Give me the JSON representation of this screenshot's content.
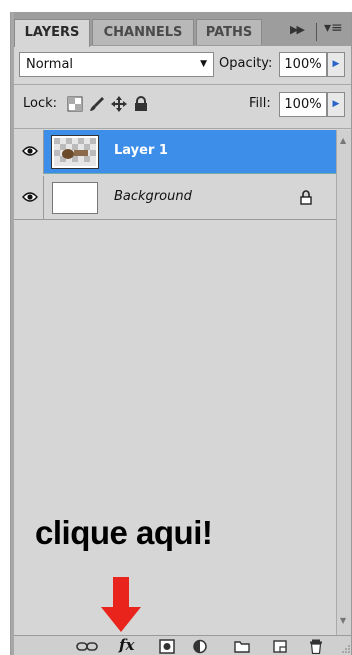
{
  "tabs": [
    {
      "label": "LAYERS",
      "active": true
    },
    {
      "label": "CHANNELS",
      "active": false
    },
    {
      "label": "PATHS",
      "active": false
    }
  ],
  "blend": {
    "mode": "Normal"
  },
  "opacity": {
    "label": "Opacity:",
    "value": "100%"
  },
  "lock": {
    "label": "Lock:"
  },
  "fill": {
    "label": "Fill:",
    "value": "100%"
  },
  "layers": [
    {
      "name": "Layer 1",
      "selected": true,
      "visible": true
    },
    {
      "name": "Background",
      "selected": false,
      "visible": true,
      "locked": true
    }
  ],
  "annotation": {
    "text": "clique aqui!"
  },
  "bottom_bar": {
    "fx_label": "fx"
  },
  "icons": [
    "eye-icon",
    "link-icon",
    "fx-icon",
    "mask-icon",
    "adjustment-icon",
    "folder-icon",
    "new-layer-icon",
    "trash-icon",
    "lock-icon",
    "move-icon",
    "brush-icon",
    "checker-icon"
  ],
  "colors": {
    "selection": "#3d8ee8",
    "arrow": "#e8241c",
    "panel": "#d6d6d6"
  }
}
